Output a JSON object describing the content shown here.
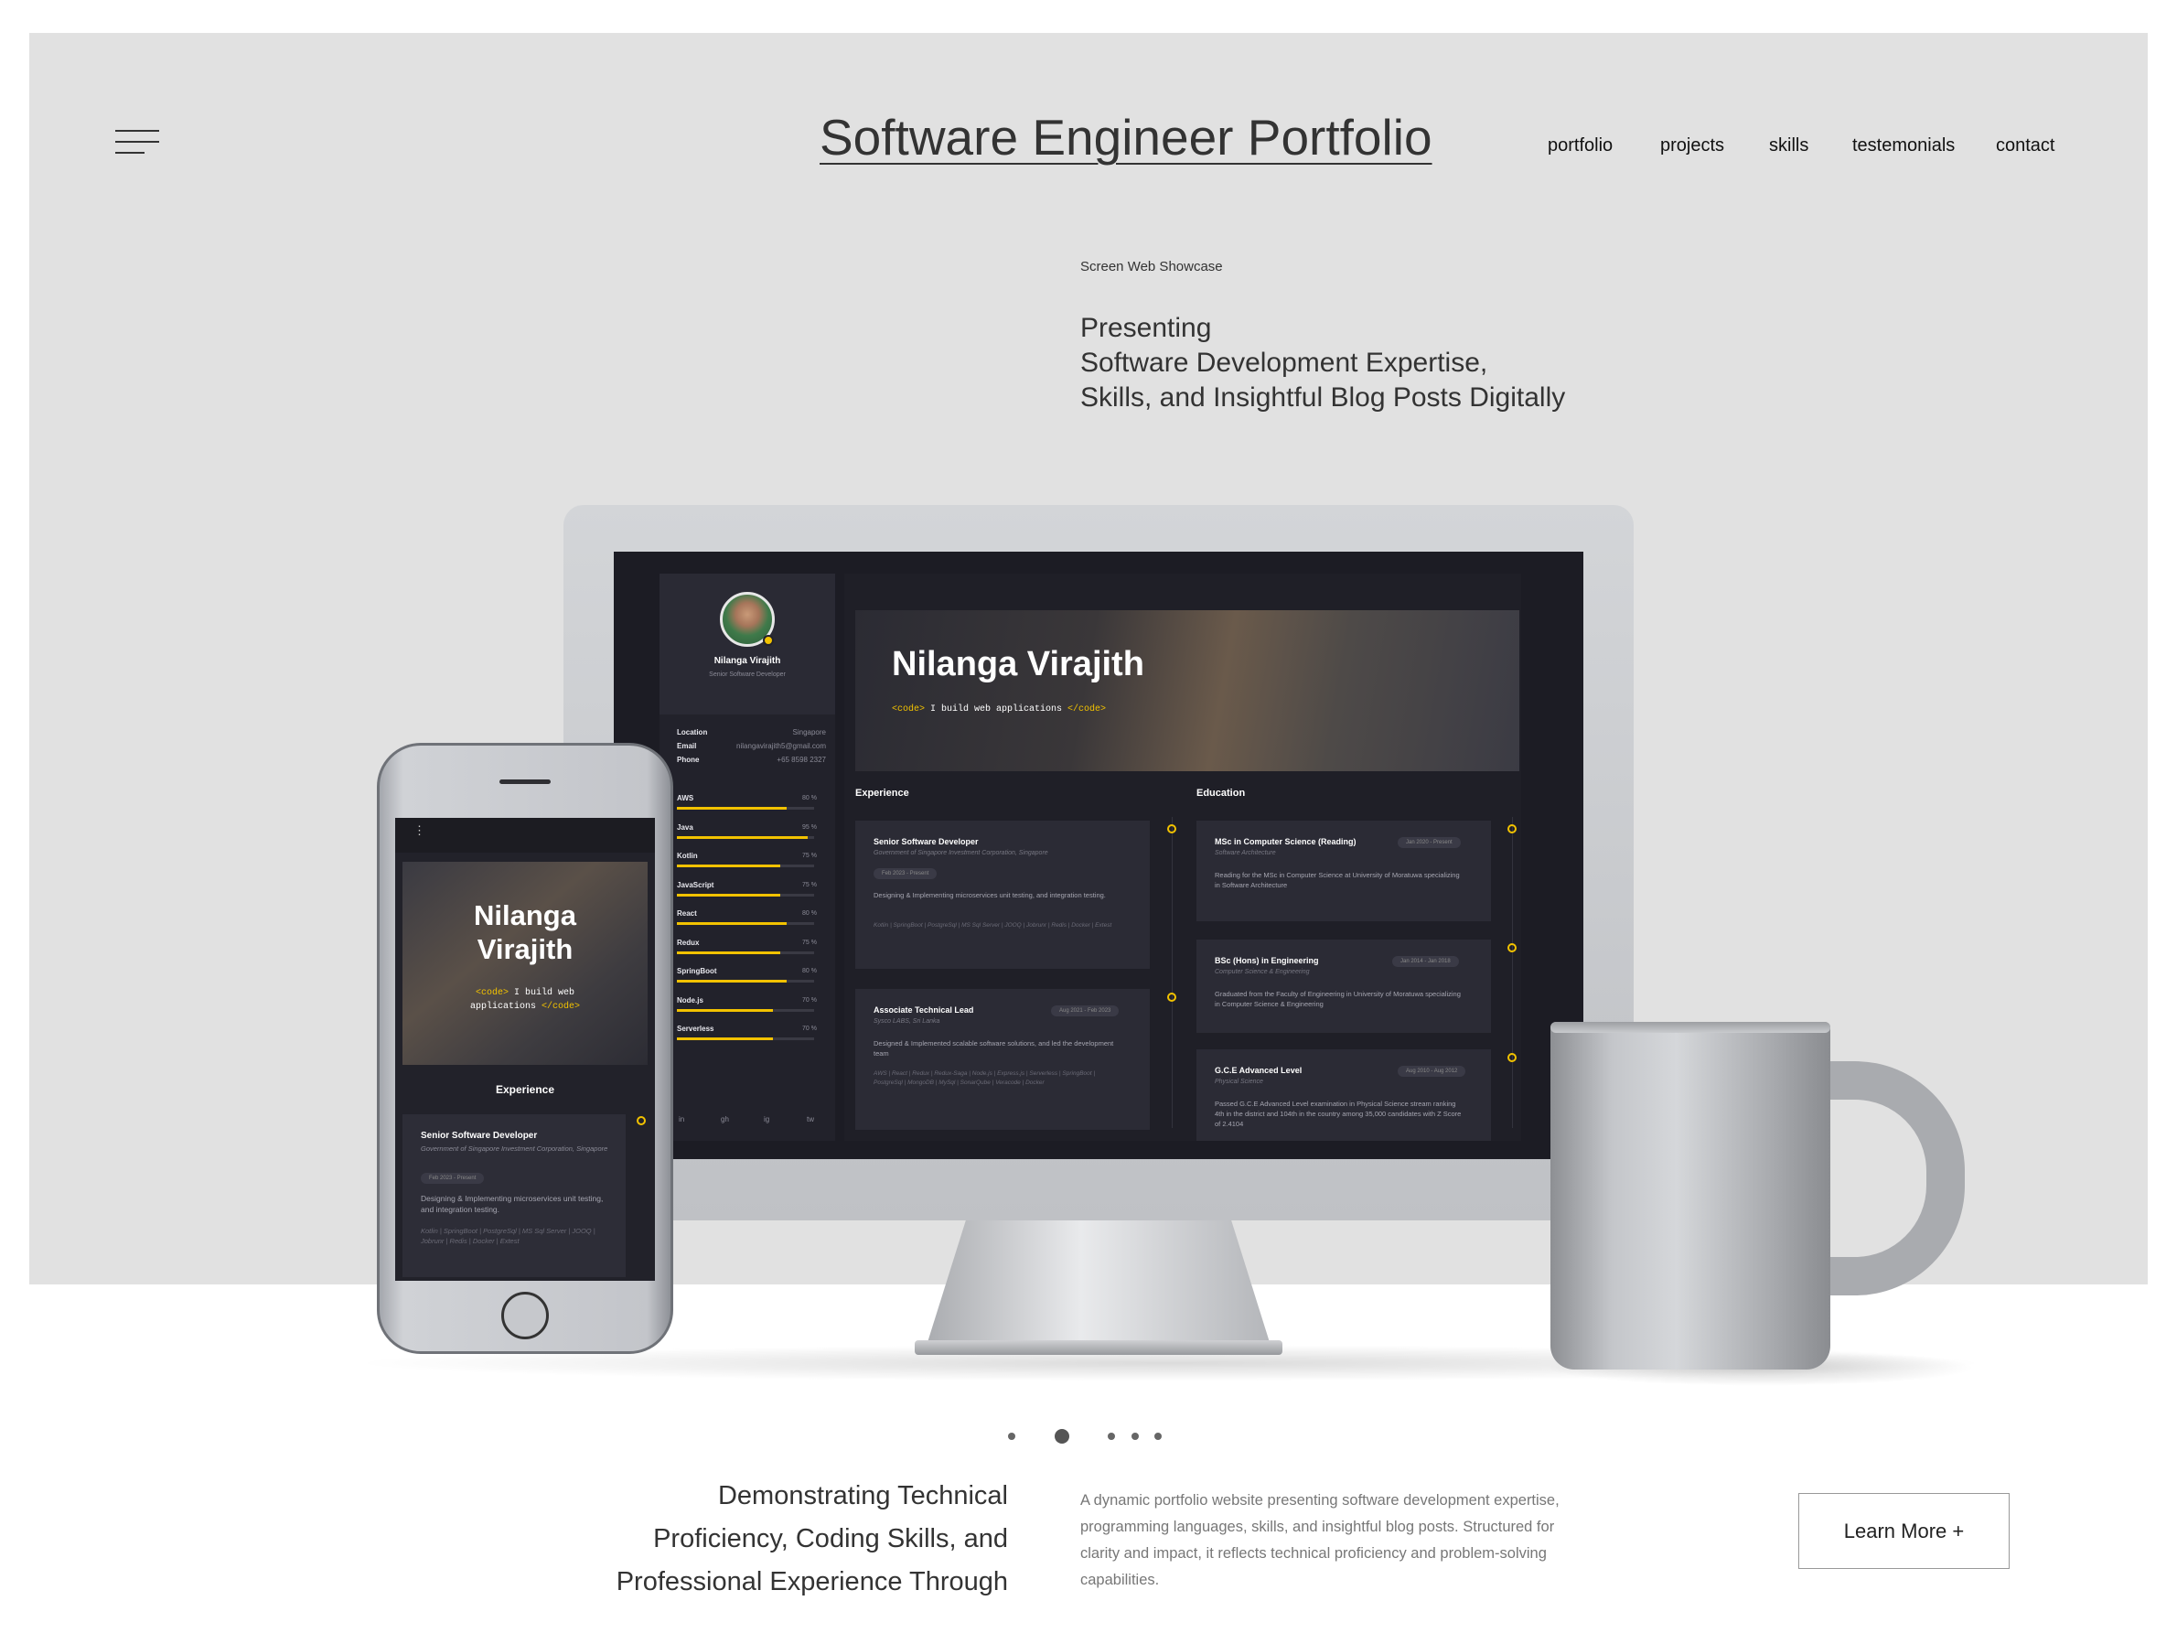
{
  "header": {
    "site_title": "Software Engineer Portfolio",
    "nav": [
      "portfolio",
      "projects",
      "skills",
      "testemonials",
      "contact"
    ]
  },
  "hero": {
    "eyebrow": "Screen Web Showcase",
    "headline": [
      "Presenting",
      "Software Development Expertise,",
      "Skills, and Insightful Blog Posts Digitally"
    ]
  },
  "showcase": {
    "profile": {
      "name": "Nilanga Virajith",
      "role": "Senior Software Developer"
    },
    "info": [
      {
        "key": "Location",
        "value": "Singapore"
      },
      {
        "key": "Email",
        "value": "nilangavirajith5@gmail.com"
      },
      {
        "key": "Phone",
        "value": "+65 8598 2327"
      }
    ],
    "skills": [
      {
        "name": "AWS",
        "pct": "80 %",
        "value": 80
      },
      {
        "name": "Java",
        "pct": "95 %",
        "value": 95
      },
      {
        "name": "Kotlin",
        "pct": "75 %",
        "value": 75
      },
      {
        "name": "JavaScript",
        "pct": "75 %",
        "value": 75
      },
      {
        "name": "React",
        "pct": "80 %",
        "value": 80
      },
      {
        "name": "Redux",
        "pct": "75 %",
        "value": 75
      },
      {
        "name": "SpringBoot",
        "pct": "80 %",
        "value": 80
      },
      {
        "name": "Node.js",
        "pct": "70 %",
        "value": 70
      },
      {
        "name": "Serverless",
        "pct": "70 %",
        "value": 70
      }
    ],
    "social": [
      "in",
      "gh",
      "ig",
      "tw"
    ],
    "banner": {
      "name": "Nilanga Virajith",
      "tag_open": "<code>",
      "tag_text": " I build web applications ",
      "tag_close": "</code>"
    },
    "sections": {
      "experience": "Experience",
      "education": "Education"
    },
    "experience": [
      {
        "title": "Senior Software Developer",
        "org": "Government of Singapore Investment Corporation, Singapore",
        "date": "Feb 2023 - Present",
        "desc": "Designing & Implementing microservices unit testing, and integration testing.",
        "tech": "Kotlin | SpringBoot | PostgreSql | MS Sql Server | JOOQ | Jobrunr | Redis | Docker | Extest"
      },
      {
        "title": "Associate Technical Lead",
        "org": "Sysco LABS, Sri Lanka",
        "date": "Aug 2021 - Feb 2023",
        "desc": "Designed & Implemented scalable software solutions, and led the development team",
        "tech": "AWS | React | Redux | Redux-Saga | Node.js | Express.js | Serverless | SpringBoot | PostgreSql | MongoDB | MySql | SonarQube | Veracode | Docker"
      }
    ],
    "education": [
      {
        "title": "MSc in Computer Science (Reading)",
        "field": "Software Architecture",
        "date": "Jan 2020 - Present",
        "desc": "Reading for the MSc in Computer Science at University of Moratuwa specializing in Software Architecture"
      },
      {
        "title": "BSc (Hons) in Engineering",
        "field": "Computer Science & Engineering",
        "date": "Jan 2014 - Jan 2018",
        "desc": "Graduated from the Faculty of Engineering in University of Moratuwa specializing in Computer Science & Engineering"
      },
      {
        "title": "G.C.E Advanced Level",
        "field": "Physical Science",
        "date": "Aug 2010 - Aug 2012",
        "desc": "Passed G.C.E Advanced Level examination in Physical Science stream ranking 4th in the district and 104th in the country among 35,000 candidates with Z Score of 2.4104"
      }
    ],
    "phone": {
      "menu_icon": "⋮",
      "name_line1": "Nilanga",
      "name_line2": "Virajith",
      "tag_line1_pre": "<code>",
      "tag_line1_text": " I build web",
      "tag_line2_text": "applications ",
      "tag_line2_post": "</code>",
      "section": "Experience",
      "card_title": "Senior Software Developer",
      "card_org": "Government of Singapore Investment Corporation, Singapore",
      "card_date": "Feb 2023 - Present",
      "card_desc": "Designing & Implementing microservices unit testing, and integration testing.",
      "card_tech": "Kotlin | SpringBoot | PostgreSql | MS Sql Server | JOOQ | Jobrunr | Redis | Docker | Extest"
    }
  },
  "slider": {
    "dots": 5,
    "active": 1
  },
  "bottom": {
    "heading": [
      "Demonstrating Technical",
      "Proficiency, Coding Skills, and",
      "Professional Experience Through"
    ],
    "description": "A dynamic portfolio website presenting software development expertise, programming languages, skills, and insightful blog posts. Structured for clarity and impact, it reflects technical proficiency and problem-solving capabilities.",
    "button": "Learn More +"
  },
  "colors": {
    "accent": "#f2c200",
    "hero_bg": "#e1e1e1",
    "screen_bg": "#1c1c24"
  }
}
